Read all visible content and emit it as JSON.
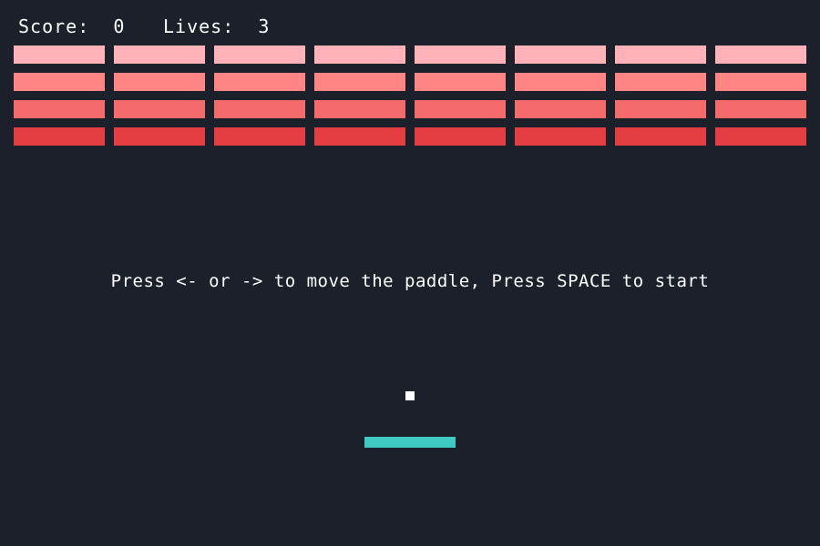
{
  "hud": {
    "score_label": "Score:",
    "score_value": "0",
    "lives_label": "Lives:",
    "lives_value": "3"
  },
  "message": "Press <- or -> to move the paddle, Press SPACE to start",
  "bricks": {
    "rows": [
      {
        "color": "#ffb3b8",
        "count": 8
      },
      {
        "color": "#ff8585",
        "count": 8
      },
      {
        "color": "#f56b6b",
        "count": 8
      },
      {
        "color": "#e43e42",
        "count": 8
      }
    ]
  },
  "colors": {
    "background": "#1b202b",
    "ball": "#ffffff",
    "paddle": "#3fcbc3",
    "text": "#ffffff"
  }
}
